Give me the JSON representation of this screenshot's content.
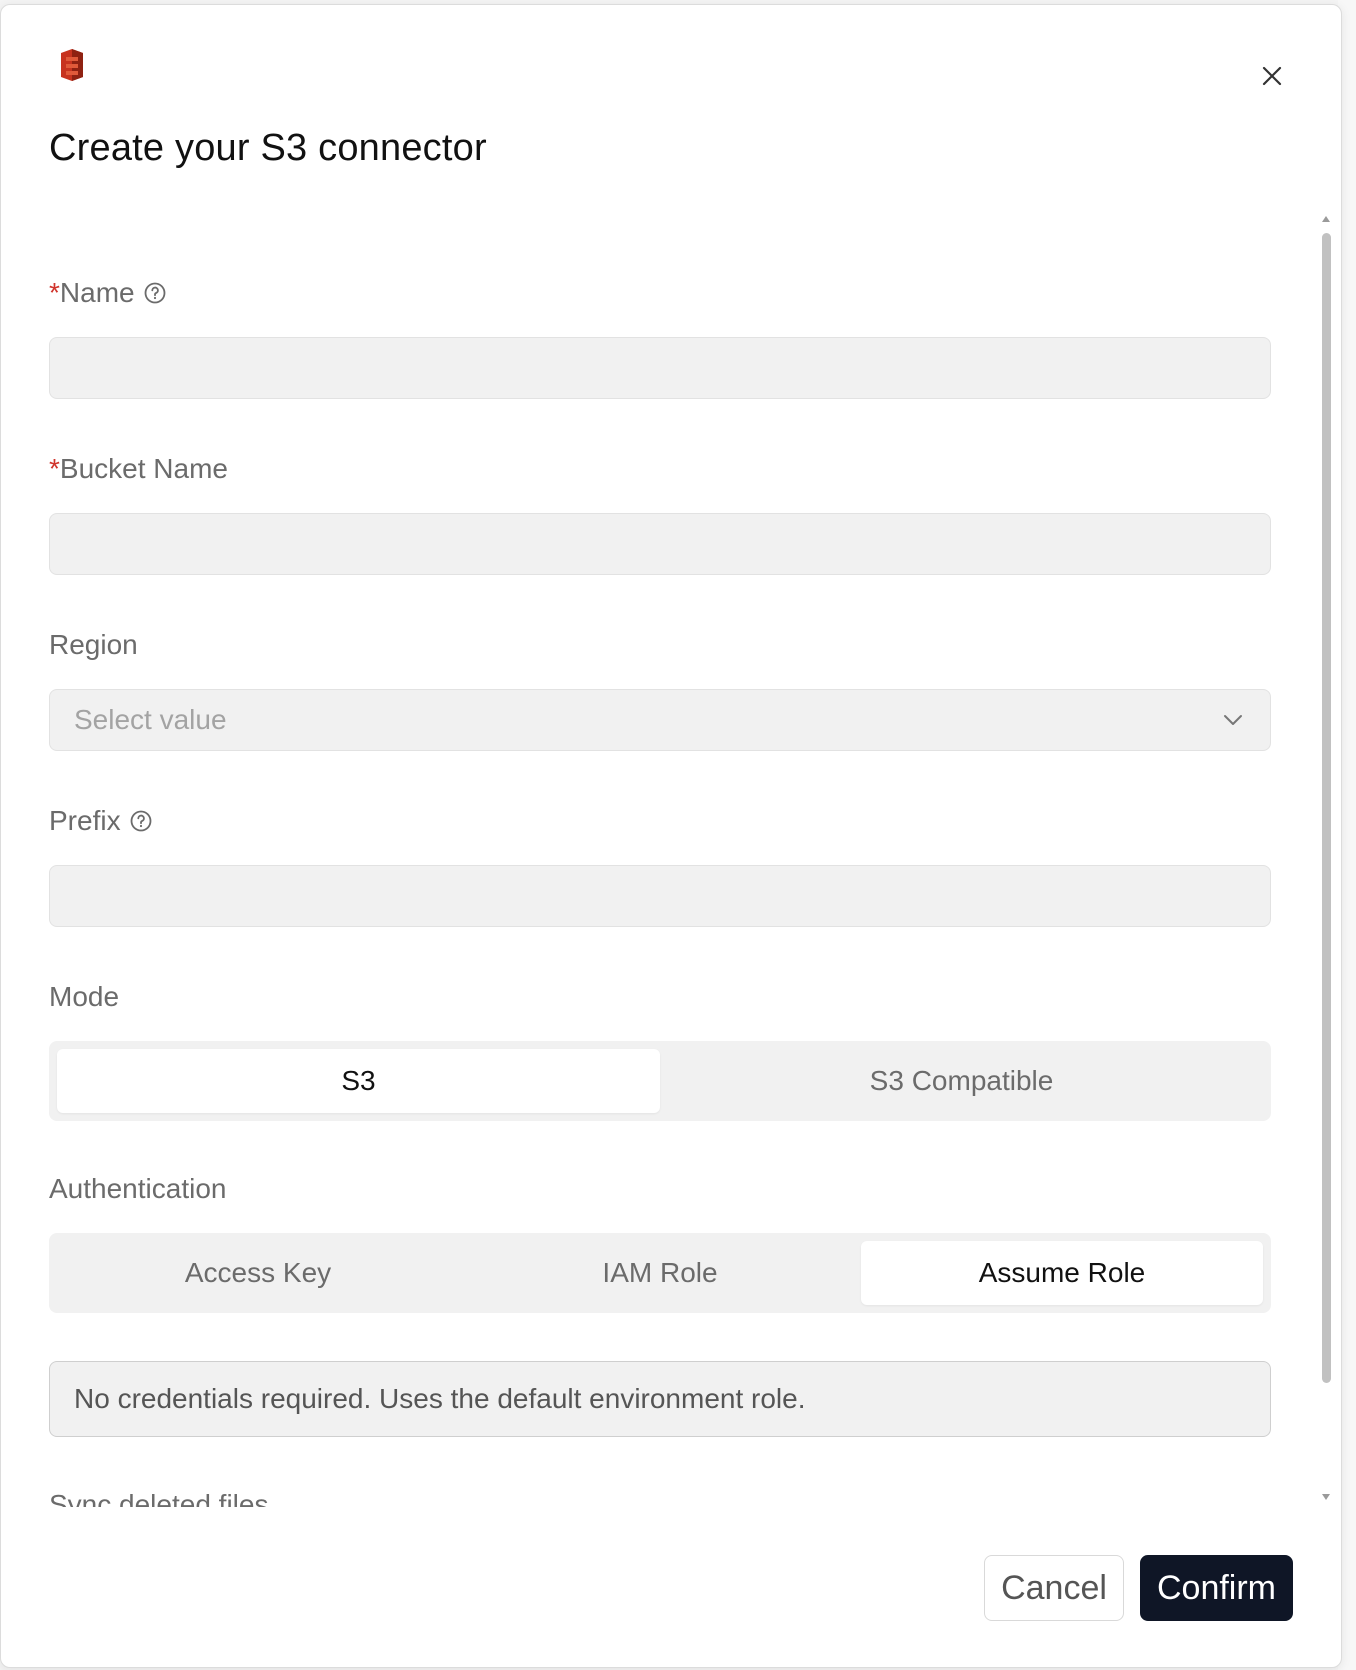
{
  "dialog": {
    "title": "Create your S3 connector",
    "logo_icon": "amazon-s3-logo",
    "close_icon": "close-icon"
  },
  "form": {
    "name": {
      "required_mark": "*",
      "label": "Name",
      "value": "",
      "help_icon": "help-circle-icon"
    },
    "bucket_name": {
      "required_mark": "*",
      "label": "Bucket Name",
      "value": ""
    },
    "region": {
      "label": "Region",
      "placeholder": "Select value",
      "icon": "chevron-down-icon"
    },
    "prefix": {
      "label": "Prefix",
      "value": "",
      "help_icon": "help-circle-icon"
    },
    "mode": {
      "label": "Mode",
      "options": [
        "S3",
        "S3 Compatible"
      ],
      "selected": "S3"
    },
    "authentication": {
      "label": "Authentication",
      "options": [
        "Access Key",
        "IAM Role",
        "Assume Role"
      ],
      "selected": "Assume Role"
    },
    "info_message": "No credentials required. Uses the default environment role.",
    "sync_deleted_files_label": "Sync deleted files"
  },
  "footer": {
    "cancel_label": "Cancel",
    "confirm_label": "Confirm"
  },
  "colors": {
    "required": "#d0342c",
    "primary_button": "#0f1626",
    "input_bg": "#f1f1f1",
    "s3_logo": "#c7331f"
  }
}
